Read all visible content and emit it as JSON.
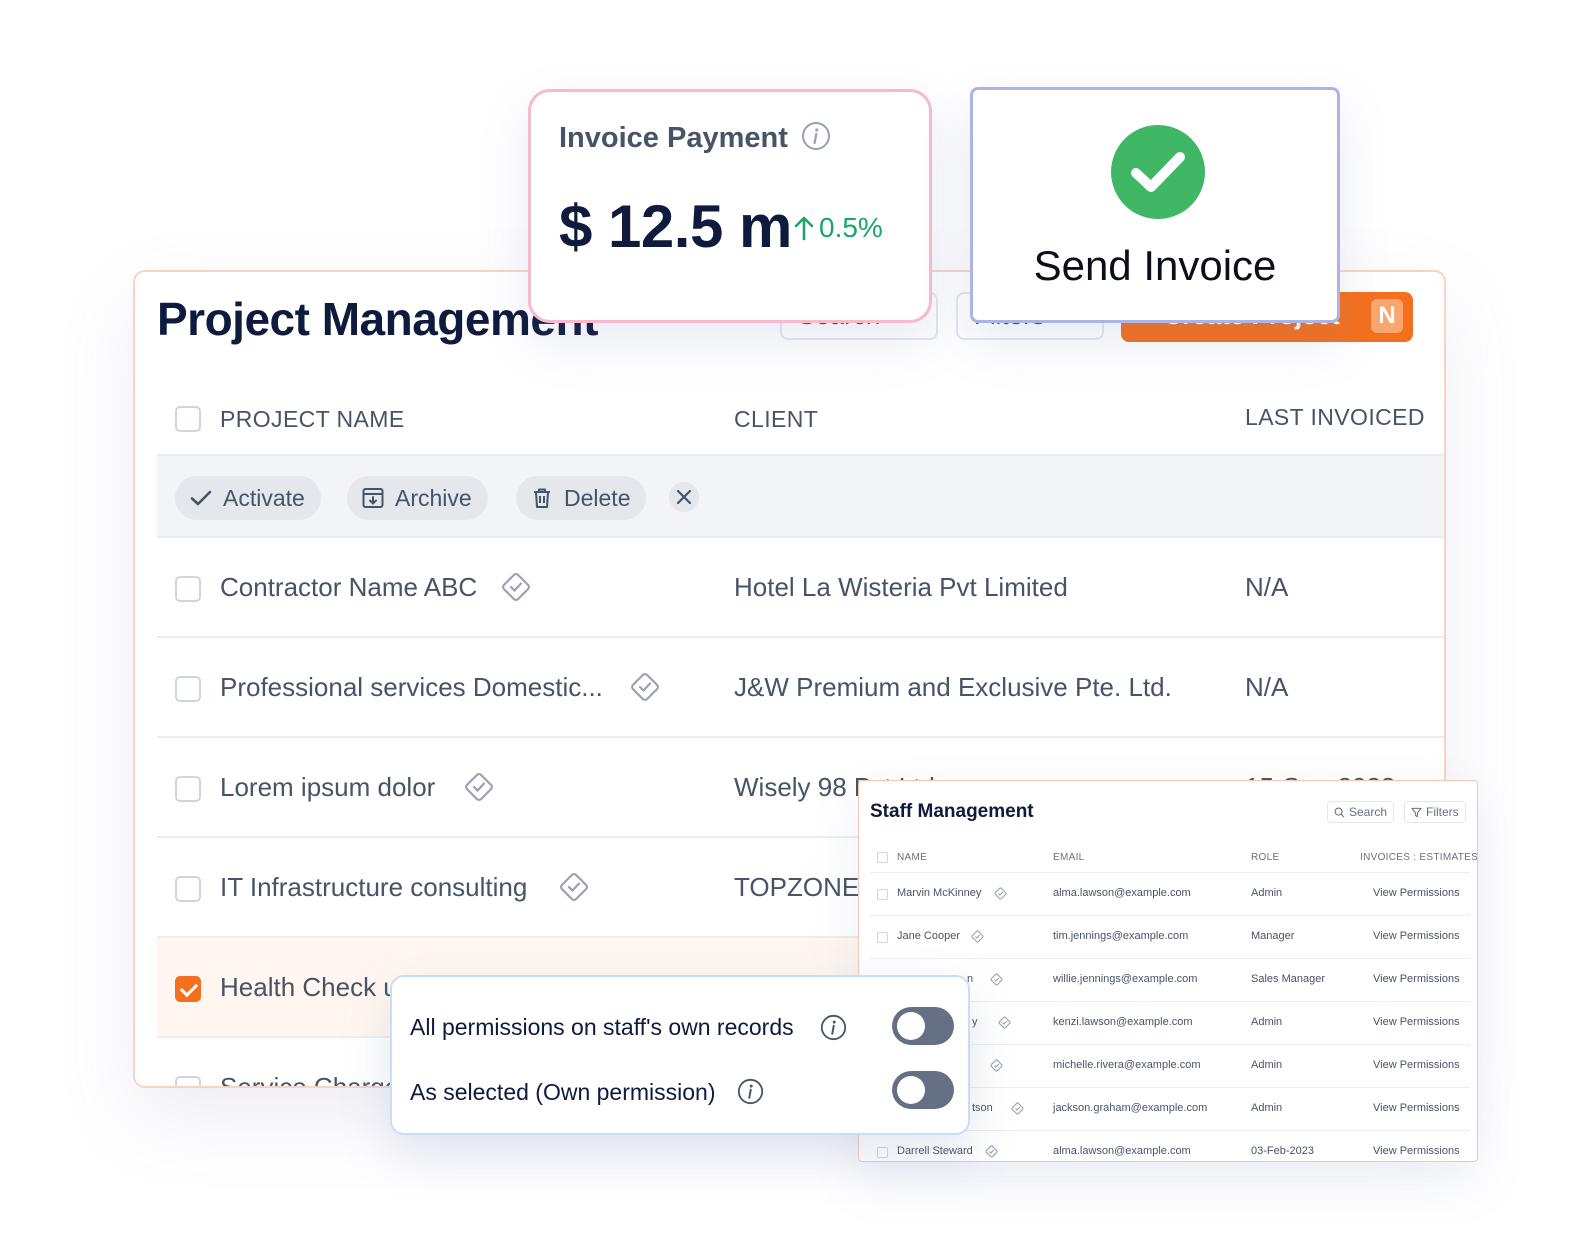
{
  "project_management": {
    "title": "Project Management",
    "toolbar": {
      "search_label": "Search",
      "filters_label": "Filters",
      "create_label": "+ Create Project",
      "create_shortcut": "N"
    },
    "columns": {
      "project_name": "PROJECT NAME",
      "client": "CLIENT",
      "last_invoiced": "LAST INVOICED"
    },
    "bulk_actions": {
      "activate": "Activate",
      "archive": "Archive",
      "delete": "Delete"
    },
    "rows": [
      {
        "name": "Contractor Name ABC",
        "client": "Hotel La Wisteria Pvt Limited",
        "last_invoiced": "N/A",
        "checked": false
      },
      {
        "name": "Professional services Domestic...",
        "client": "J&W Premium and Exclusive Pte. Ltd.",
        "last_invoiced": "N/A",
        "checked": false
      },
      {
        "name": "Lorem ipsum dolor",
        "client": "Wisely 98 Pvt Ltd",
        "last_invoiced": "15-Sep-2023",
        "checked": false
      },
      {
        "name": "IT Infrastructure consulting",
        "client": "TOPZONE",
        "last_invoiced": "",
        "checked": false
      },
      {
        "name": "Health Check up",
        "client": "",
        "last_invoiced": "",
        "checked": true
      },
      {
        "name": "Service Charge",
        "client": "",
        "last_invoiced": "",
        "checked": false
      }
    ]
  },
  "invoice_payment": {
    "title": "Invoice Payment",
    "amount": "$ 12.5 m",
    "change": "0.5%",
    "change_color": "#1aa66a"
  },
  "send_invoice": {
    "label": "Send Invoice",
    "check_color": "#3fb765"
  },
  "staff_management": {
    "title": "Staff Management",
    "search_label": "Search",
    "filters_label": "Filters",
    "columns": {
      "name": "NAME",
      "email": "EMAIL",
      "role": "ROLE",
      "invoices": "INVOICES : ESTIMATES"
    },
    "rows": [
      {
        "name": "Marvin McKinney",
        "email": "alma.lawson@example.com",
        "role": "Admin",
        "action": "View Permissions"
      },
      {
        "name": "Jane Cooper",
        "email": "tim.jennings@example.com",
        "role": "Manager",
        "action": "View Permissions"
      },
      {
        "name": "n",
        "email": "willie.jennings@example.com",
        "role": "Sales Manager",
        "action": "View Permissions"
      },
      {
        "name": "y",
        "email": "kenzi.lawson@example.com",
        "role": "Admin",
        "action": "View Permissions"
      },
      {
        "name": "",
        "email": "michelle.rivera@example.com",
        "role": "Admin",
        "action": "View Permissions"
      },
      {
        "name": "tson",
        "email": "jackson.graham@example.com",
        "role": "Admin",
        "action": "View Permissions"
      },
      {
        "name": "Darrell Steward",
        "email": "alma.lawson@example.com",
        "role": "03-Feb-2023",
        "action": "View Permissions"
      }
    ]
  },
  "permissions": {
    "option1": "All permissions on staff's own records",
    "option2": "As selected (Own permission)"
  },
  "colors": {
    "accent": "#f4701e",
    "title": "#0f1b3d",
    "toggle_off": "#667085"
  }
}
